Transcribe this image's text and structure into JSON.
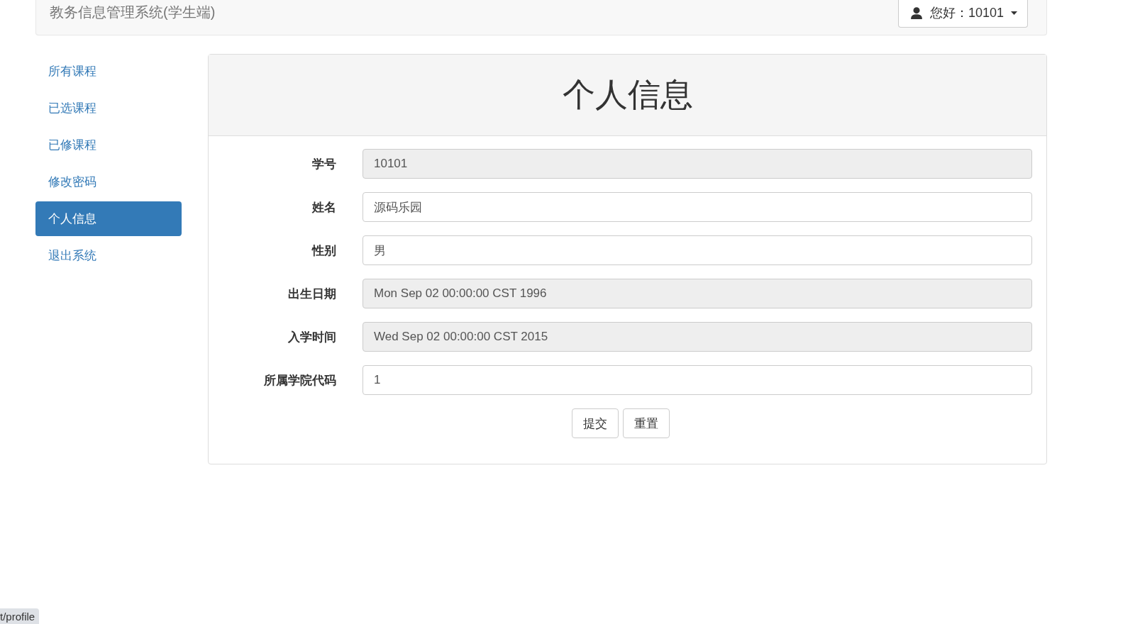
{
  "navbar": {
    "brand": "教务信息管理系统(学生端)",
    "user_menu": "您好：10101"
  },
  "sidebar": {
    "items": [
      {
        "label": "所有课程",
        "selected": false
      },
      {
        "label": "已选课程",
        "selected": false
      },
      {
        "label": "已修课程",
        "selected": false
      },
      {
        "label": "修改密码",
        "selected": false
      },
      {
        "label": "个人信息",
        "selected": true
      },
      {
        "label": "退出系统",
        "selected": false
      }
    ]
  },
  "panel": {
    "title": "个人信息",
    "fields": [
      {
        "label": "学号",
        "value": "10101",
        "disabled": true
      },
      {
        "label": "姓名",
        "value": "源码乐园",
        "disabled": false
      },
      {
        "label": "性别",
        "value": "男",
        "disabled": false
      },
      {
        "label": "出生日期",
        "value": "Mon Sep 02 00:00:00 CST 1996",
        "disabled": true
      },
      {
        "label": "入学时间",
        "value": "Wed Sep 02 00:00:00 CST 2015",
        "disabled": true
      },
      {
        "label": "所属学院代码",
        "value": "1",
        "disabled": false
      }
    ],
    "buttons": [
      "提交",
      "重置"
    ]
  },
  "status_bar": "t/profile"
}
